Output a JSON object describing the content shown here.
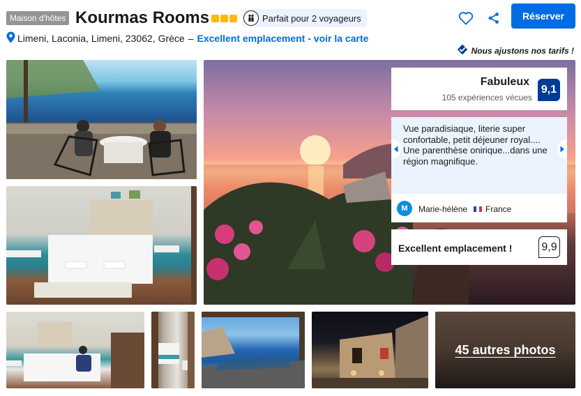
{
  "header": {
    "property_type": "Maison d'hôtes",
    "hotel_name": "Kourmas Rooms",
    "star_rating": 3,
    "travellers_badge": "Parfait pour 2 voyageurs",
    "reserve_label": "Réserver",
    "icons": [
      "heart-icon",
      "share-icon",
      "people-icon",
      "map-pin-icon",
      "price-match-icon"
    ]
  },
  "address": {
    "text": "Limeni, Laconia, Limeni, 23062, Grèce",
    "separator": "–",
    "map_link": "Excellent emplacement - voir la carte"
  },
  "price_promise": "Nous ajustons nos tarifs !",
  "gallery": {
    "more_photos_label": "45 autres photos"
  },
  "review_panel": {
    "rating_word": "Fabuleux",
    "review_count": "105 expériences vécues",
    "score": "9,1",
    "review_text": "Vue paradisiaque, literie super confortable, petit déjeuner royal.... Une parenthèse onirique...dans une région magnifique.",
    "reviewer_initial": "M",
    "reviewer_name": "Marie-hélène",
    "reviewer_country": "France",
    "location_label": "Excellent emplacement !",
    "location_score": "9,9"
  },
  "colors": {
    "brand_blue": "#006ce4",
    "score_blue": "#003b95",
    "star_yellow": "#febb02",
    "light_blue_bg": "#ebf3ff"
  }
}
